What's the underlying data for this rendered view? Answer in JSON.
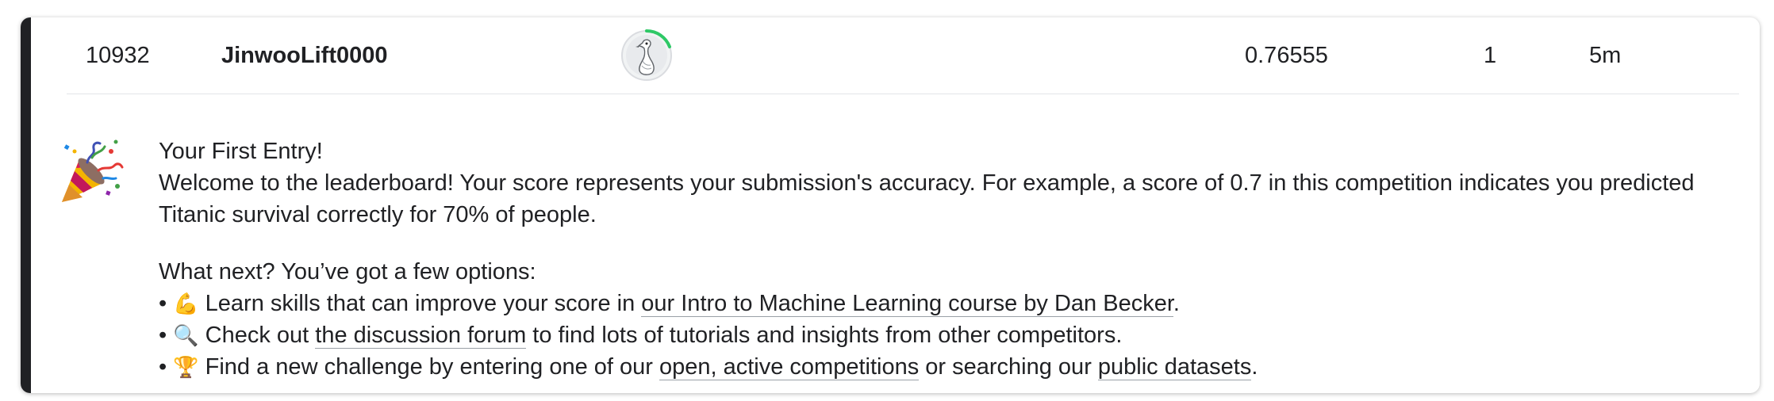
{
  "row": {
    "rank": "10932",
    "team_name": "JinwooLift0000",
    "score": "0.76555",
    "entries": "1",
    "last": "5m"
  },
  "colors": {
    "accent": "#202124",
    "progress_ring": "#20BEFF",
    "progress_ring_green": "#2ec866"
  },
  "icons": {
    "avatar": "goose-avatar",
    "celebration": "party-popper"
  },
  "message": {
    "title": "Your First Entry!",
    "welcome": "Welcome to the leaderboard! Your score represents your submission's accuracy. For example, a score of 0.7 in this competition indicates you predicted Titanic survival correctly for 70% of people.",
    "next_heading": "What next? You’ve got a few options:",
    "options": [
      {
        "bullet": "•",
        "emoji": "💪",
        "before": " Learn skills that can improve your score in ",
        "link": "our Intro to Machine Learning course by Dan Becker",
        "after": "."
      },
      {
        "bullet": "•",
        "emoji": "🔍",
        "before": " Check out ",
        "link": "the discussion forum",
        "after": " to find lots of tutorials and insights from other competitors."
      },
      {
        "bullet": "•",
        "emoji": "🏆",
        "before": " Find a new challenge by entering one of our ",
        "link": "open, active competitions",
        "middle": " or searching our ",
        "link2": "public datasets",
        "after": "."
      }
    ]
  }
}
